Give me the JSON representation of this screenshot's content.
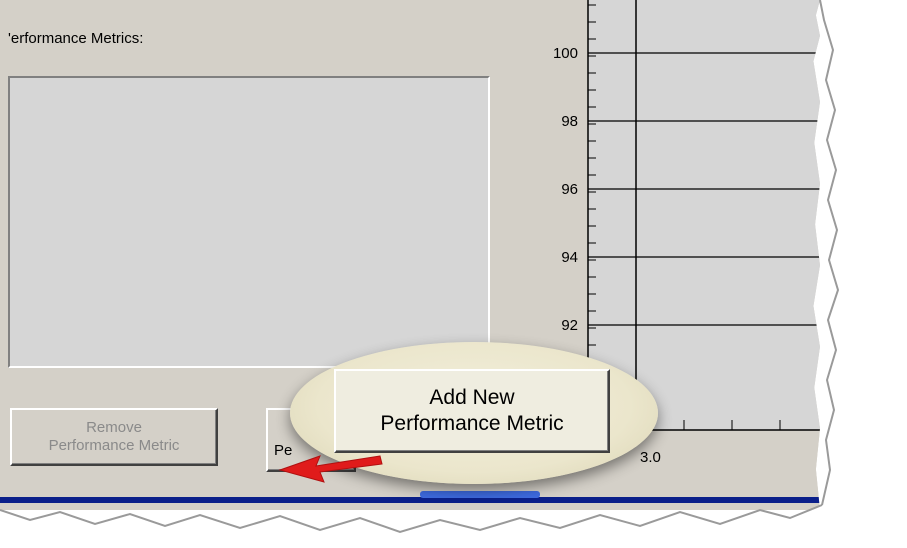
{
  "panel": {
    "label": "'erformance Metrics:",
    "remove_button": {
      "line1": "Remove",
      "line2": "Performance Metric",
      "enabled": false
    },
    "partial_button_text": "Pe"
  },
  "chart": {
    "y_ticks": [
      "100",
      "98",
      "96",
      "94",
      "92"
    ],
    "x_tick_partial": "3.0",
    "colors": {
      "background": "#d6d6d6",
      "gridline": "#000000"
    }
  },
  "callout": {
    "line1": "Add New",
    "line2": "Performance Metric"
  },
  "colors": {
    "window_bg": "#d4d0c8",
    "status_bar": "#0a1f8a",
    "arrow": "#e01b1b"
  }
}
